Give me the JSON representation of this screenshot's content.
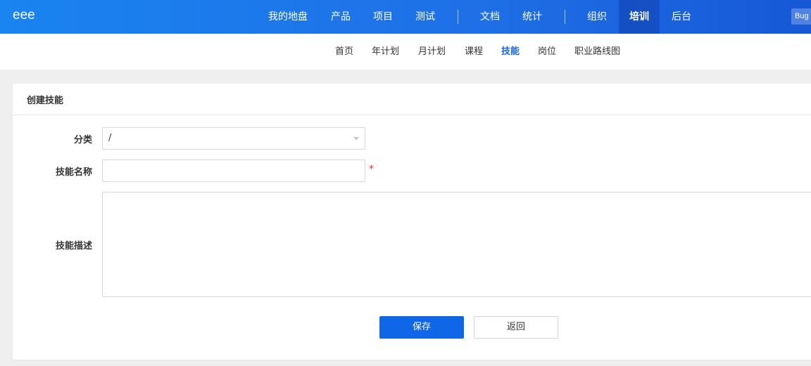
{
  "header": {
    "brand": "eee",
    "nav": [
      {
        "label": "我的地盘"
      },
      {
        "label": "产品"
      },
      {
        "label": "项目"
      },
      {
        "label": "测试"
      },
      {
        "label": "文档"
      },
      {
        "label": "统计"
      },
      {
        "label": "组织"
      },
      {
        "label": "培训",
        "active": true
      },
      {
        "label": "后台"
      }
    ],
    "bug_badge": "Bug"
  },
  "subnav": {
    "items": [
      {
        "label": "首页"
      },
      {
        "label": "年计划"
      },
      {
        "label": "月计划"
      },
      {
        "label": "课程"
      },
      {
        "label": "技能",
        "active": true
      },
      {
        "label": "岗位"
      },
      {
        "label": "职业路线图"
      }
    ]
  },
  "form": {
    "title": "创建技能",
    "category_label": "分类",
    "category_value": "/",
    "name_label": "技能名称",
    "name_value": "",
    "required_mark": "*",
    "description_label": "技能描述",
    "description_value": "",
    "save_label": "保存",
    "back_label": "返回"
  },
  "colors": {
    "header_gradient_start": "#1a84f0",
    "header_gradient_end": "#1658d6",
    "active_nav_bg": "#1450c4",
    "accent": "#1a66d9",
    "primary_button": "#0f66e6",
    "required": "#e33333"
  }
}
